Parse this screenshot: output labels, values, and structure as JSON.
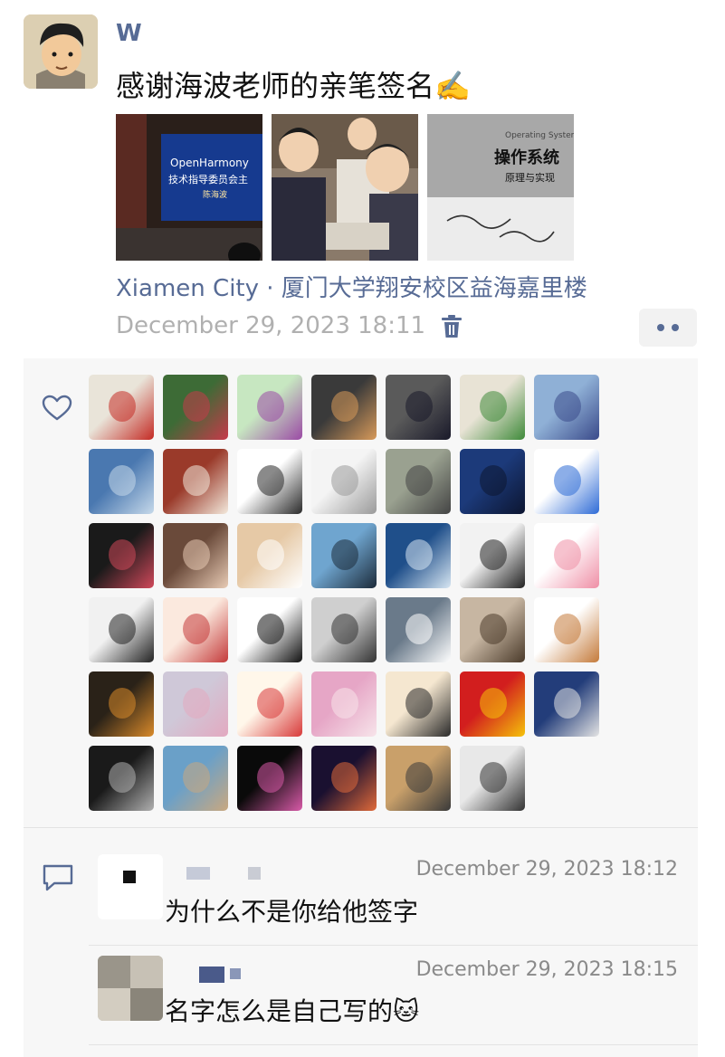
{
  "post": {
    "author": "W",
    "text": "感谢海波老师的亲笔签名✍️",
    "photos": [
      {
        "alt": "OpenHarmony 技术指导委员会 讲座投影",
        "screen_title": "OpenHarmony",
        "screen_subtitle": "技术指导委员会主",
        "screen_name": "陈海波"
      },
      {
        "alt": "签名现场"
      },
      {
        "alt": "操作系统 原理与实现 签名页",
        "book_title": "操作系统",
        "book_subtitle": "原理与实现",
        "book_en": "Operating Systems"
      }
    ],
    "location": "Xiamen City · 厦门大学翔安校区益海嘉里楼",
    "timestamp": "December 29, 2023 18:11",
    "icons": {
      "delete": "trash-icon",
      "more": "more-options-icon"
    }
  },
  "likes": {
    "icon": "heart-icon",
    "avatars": [
      {
        "name": "likes-avatar-red-kids",
        "colors": [
          "#e9e4d9",
          "#c42b24"
        ]
      },
      {
        "name": "likes-avatar-camellia",
        "colors": [
          "#3d6b36",
          "#c73a4a"
        ]
      },
      {
        "name": "likes-avatar-pig-cartoon",
        "colors": [
          "#c7e7c1",
          "#9b4aa5"
        ]
      },
      {
        "name": "likes-avatar-silhouette-dusk",
        "colors": [
          "#3a3a3a",
          "#d89a5a"
        ]
      },
      {
        "name": "likes-avatar-man-jersey",
        "colors": [
          "#5a5a5a",
          "#1a1a2a"
        ]
      },
      {
        "name": "likes-avatar-dog-melon",
        "colors": [
          "#e8e3d5",
          "#3f8a3a"
        ]
      },
      {
        "name": "likes-avatar-sleeping-anime",
        "colors": [
          "#8fb0d6",
          "#3a4a8a"
        ]
      },
      {
        "name": "likes-avatar-mountain-lake",
        "colors": [
          "#4a78b0",
          "#c6d9ea"
        ]
      },
      {
        "name": "likes-avatar-lucky-cat",
        "colors": [
          "#9a3a2a",
          "#f3e9dc"
        ]
      },
      {
        "name": "likes-avatar-deer",
        "colors": [
          "#ffffff",
          "#2a2a2a"
        ]
      },
      {
        "name": "likes-avatar-anime-sketch",
        "colors": [
          "#f4f4f4",
          "#9a9a9a"
        ]
      },
      {
        "name": "likes-avatar-man-painting",
        "colors": [
          "#9aa190",
          "#444444"
        ]
      },
      {
        "name": "likes-avatar-silhouette-blue",
        "colors": [
          "#1c3a7a",
          "#0c1530"
        ]
      },
      {
        "name": "likes-avatar-astronaut",
        "colors": [
          "#ffffff",
          "#2e6bd6"
        ]
      },
      {
        "name": "likes-avatar-pink-bear",
        "colors": [
          "#1a1a1a",
          "#d0485a"
        ]
      },
      {
        "name": "likes-avatar-baby-bunny",
        "colors": [
          "#6a4a3a",
          "#e8cbb5"
        ]
      },
      {
        "name": "likes-avatar-cat-face",
        "colors": [
          "#e6c9a6",
          "#ffffff"
        ]
      },
      {
        "name": "likes-avatar-penguin-ice",
        "colors": [
          "#6fa5cf",
          "#1c2b3a"
        ]
      },
      {
        "name": "likes-avatar-ocean-wave",
        "colors": [
          "#1f4f8a",
          "#d7e6f2"
        ]
      },
      {
        "name": "likes-avatar-man-white",
        "colors": [
          "#f2f2f2",
          "#222222"
        ]
      },
      {
        "name": "likes-avatar-pink-stroke",
        "colors": [
          "#ffffff",
          "#ef8fa6"
        ]
      },
      {
        "name": "likes-avatar-baby-panda",
        "colors": [
          "#f1f1f1",
          "#222222"
        ]
      },
      {
        "name": "likes-avatar-justin-bieber",
        "colors": [
          "#fbe9de",
          "#c43a3a"
        ]
      },
      {
        "name": "likes-avatar-smiley",
        "colors": [
          "#ffffff",
          "#111111"
        ]
      },
      {
        "name": "likes-avatar-anime-boy",
        "colors": [
          "#cfcfcf",
          "#333333"
        ]
      },
      {
        "name": "likes-avatar-cat-sunglasses",
        "colors": [
          "#6a7a8a",
          "#ffffff"
        ]
      },
      {
        "name": "likes-avatar-couple",
        "colors": [
          "#c7b6a2",
          "#4a3a2a"
        ]
      },
      {
        "name": "likes-avatar-monk-cartoon",
        "colors": [
          "#ffffff",
          "#c47a3a"
        ]
      },
      {
        "name": "likes-avatar-temple-night",
        "colors": [
          "#2a2218",
          "#d98a2a"
        ]
      },
      {
        "name": "likes-avatar-cat-sleeping",
        "colors": [
          "#cfc8d8",
          "#e3a9c0"
        ]
      },
      {
        "name": "likes-avatar-girl-cartoon",
        "colors": [
          "#fff7ea",
          "#d83a3a"
        ]
      },
      {
        "name": "likes-avatar-pig-bunny",
        "colors": [
          "#e6a6c6",
          "#f7e4ea"
        ]
      },
      {
        "name": "likes-avatar-boy-cartoon",
        "colors": [
          "#f5e7d0",
          "#2a2a2a"
        ]
      },
      {
        "name": "likes-avatar-yinyang",
        "colors": [
          "#d21e1e",
          "#f5c20a"
        ]
      },
      {
        "name": "likes-avatar-wizard",
        "colors": [
          "#233d7a",
          "#e4e4e4"
        ]
      },
      {
        "name": "likes-avatar-man-back",
        "colors": [
          "#1a1a1a",
          "#b0b0b0"
        ]
      },
      {
        "name": "likes-avatar-beach",
        "colors": [
          "#6aa0c8",
          "#c9a880"
        ]
      },
      {
        "name": "likes-avatar-lotus",
        "colors": [
          "#0a0a0a",
          "#d85aa8"
        ]
      },
      {
        "name": "likes-avatar-space-pizza",
        "colors": [
          "#1a1030",
          "#e06a3a"
        ]
      },
      {
        "name": "likes-avatar-couple-field",
        "colors": [
          "#c9a06a",
          "#3a3a3a"
        ]
      },
      {
        "name": "likes-avatar-dog-laptop",
        "colors": [
          "#e8e8e8",
          "#333333"
        ]
      }
    ]
  },
  "comments": {
    "icon": "comment-icon",
    "items": [
      {
        "time": "December 29, 2023 18:12",
        "text": "为什么不是你给他签字"
      },
      {
        "time": "December 29, 2023 18:15",
        "text": "名字怎么是自己写的🐱"
      }
    ]
  }
}
